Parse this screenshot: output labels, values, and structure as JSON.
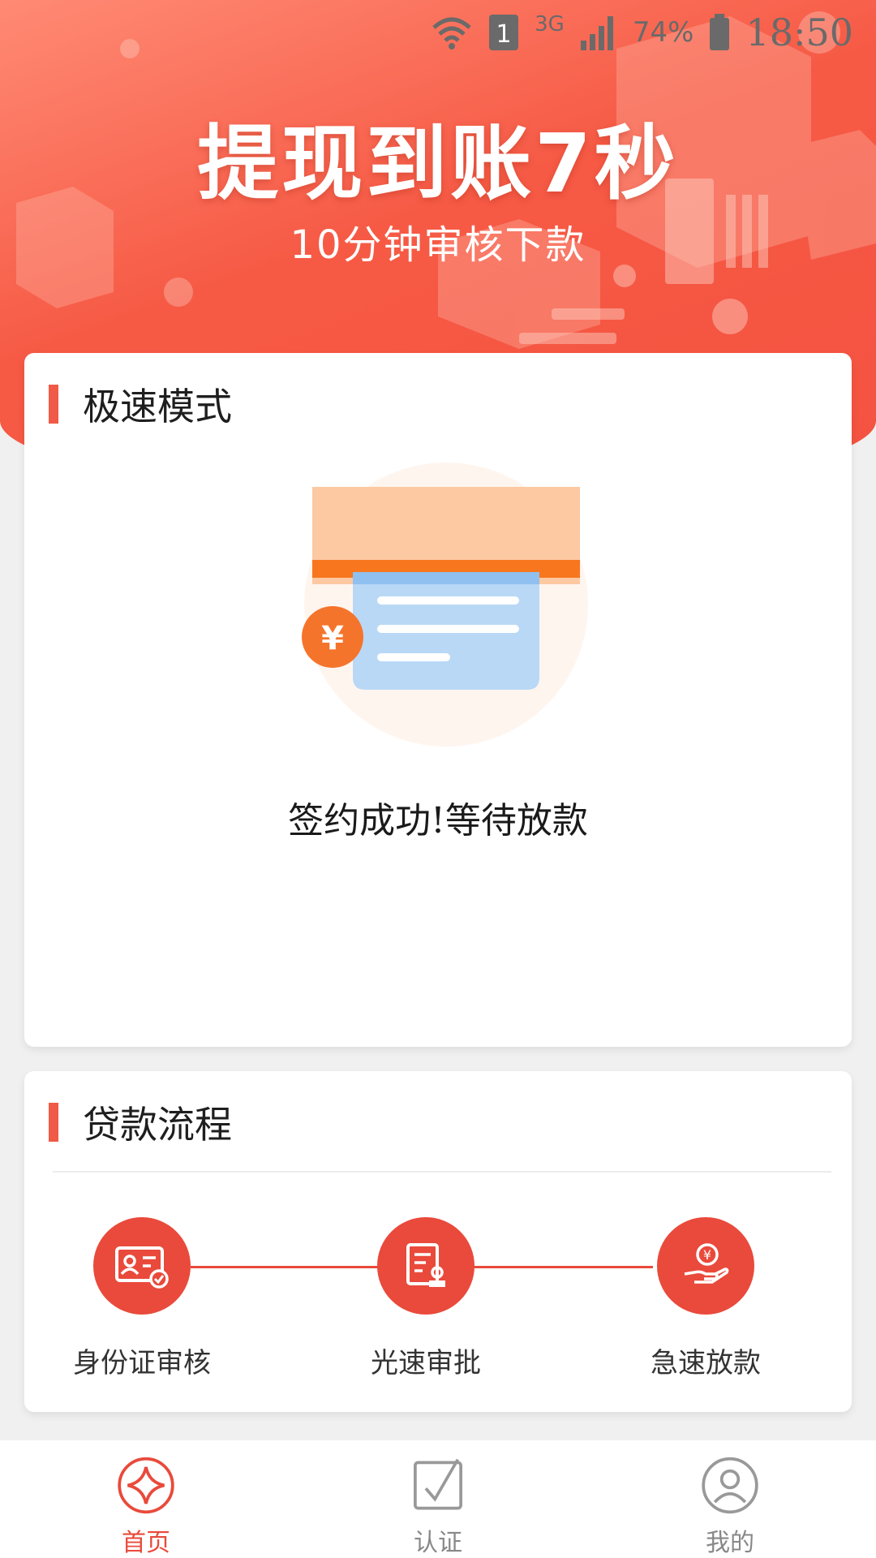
{
  "status_bar": {
    "sim": "1",
    "network": "3G",
    "battery": "74%",
    "time": "18:50"
  },
  "banner": {
    "title": "提现到账7秒",
    "subtitle": "10分钟审核下款"
  },
  "speed_card": {
    "title": "极速模式",
    "status_message": "签约成功!等待放款"
  },
  "process_card": {
    "title": "贷款流程",
    "steps": [
      {
        "label": "身份证审核",
        "icon": "id-card-icon"
      },
      {
        "label": "光速审批",
        "icon": "document-approval-icon"
      },
      {
        "label": "急速放款",
        "icon": "money-hand-icon"
      }
    ]
  },
  "bottom_nav": {
    "items": [
      {
        "label": "首页",
        "icon": "home-diamond-icon",
        "active": true
      },
      {
        "label": "认证",
        "icon": "checkbox-icon",
        "active": false
      },
      {
        "label": "我的",
        "icon": "profile-icon",
        "active": false
      }
    ]
  },
  "colors": {
    "primary": "#e94a3b",
    "banner_start": "#ff8a74",
    "banner_end": "#f45240"
  }
}
